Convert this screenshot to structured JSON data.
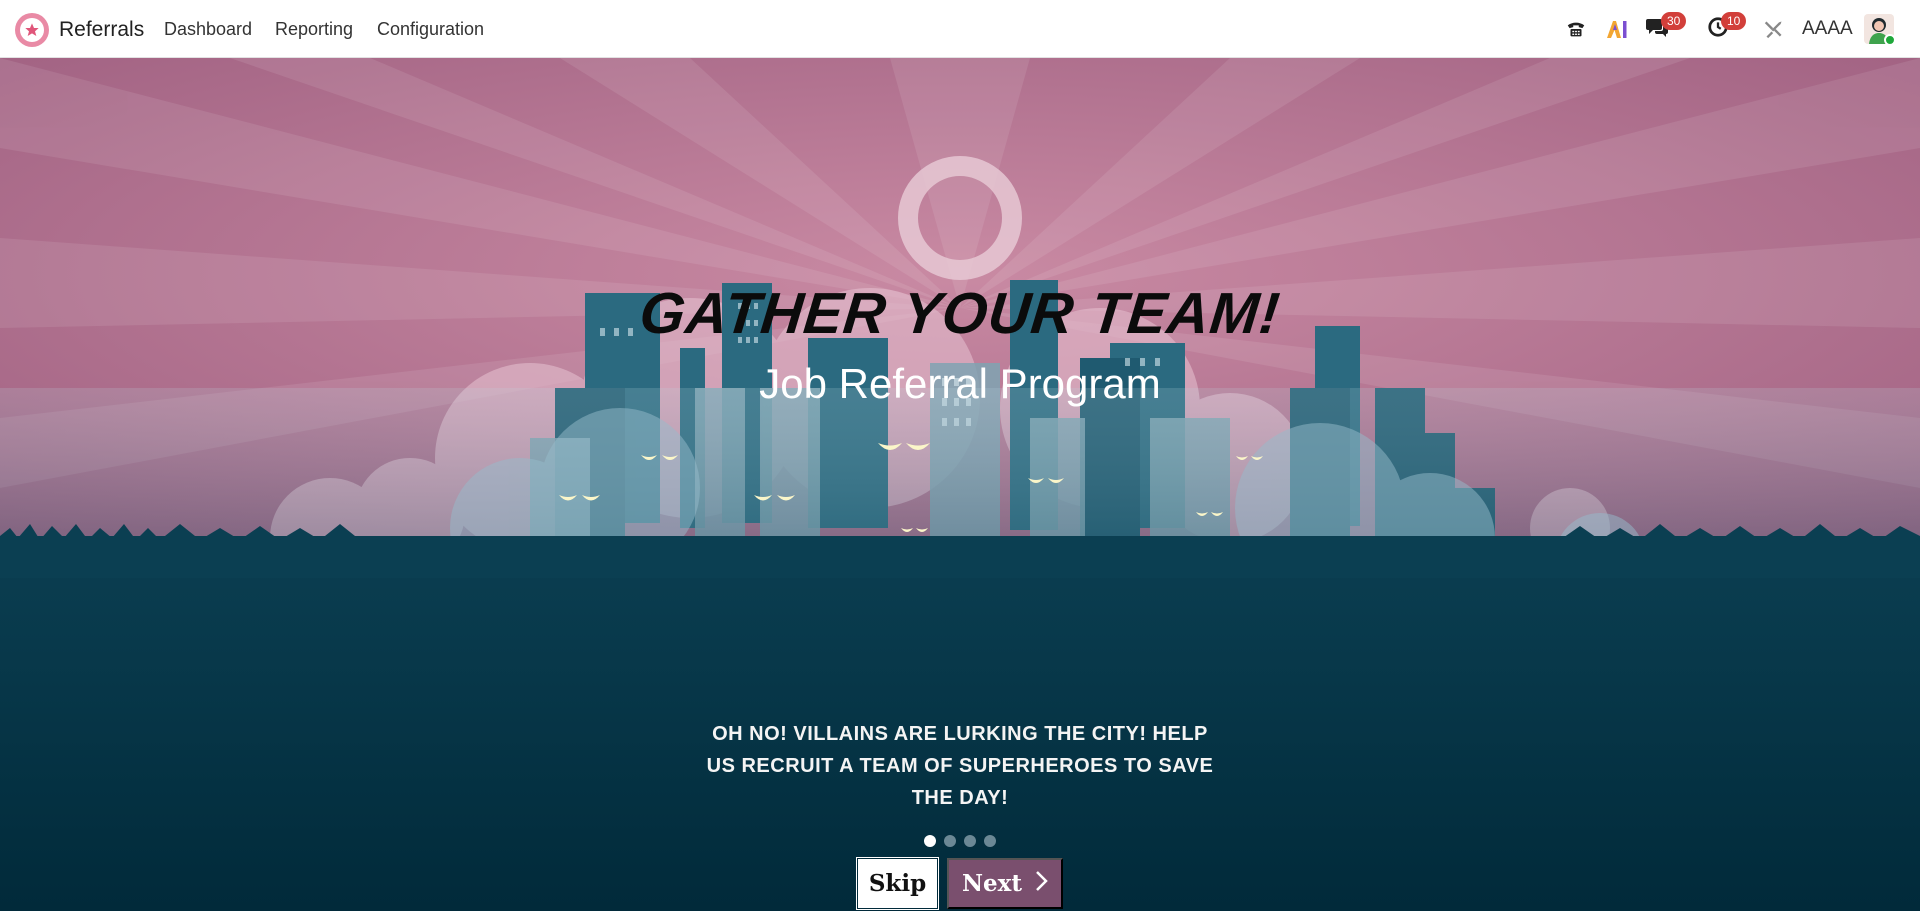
{
  "navbar": {
    "app_name": "Referrals",
    "menu": [
      "Dashboard",
      "Reporting",
      "Configuration"
    ],
    "messages_badge": "30",
    "activities_badge": "10",
    "user_name": "AAAA"
  },
  "hero": {
    "headline": "GATHER YOUR TEAM!",
    "subtitle": "Job Referral Program",
    "description": "Oh no! Villains are lurking the city! Help us recruit a team of superheroes to save the day!",
    "slide_count": 4,
    "active_slide": 1,
    "skip_label": "Skip",
    "next_label": "Next"
  },
  "colors": {
    "sky": "#b0728f",
    "ground": "#012a3a",
    "next_button": "#7a4f6e",
    "ring": "#e6c8d4"
  }
}
